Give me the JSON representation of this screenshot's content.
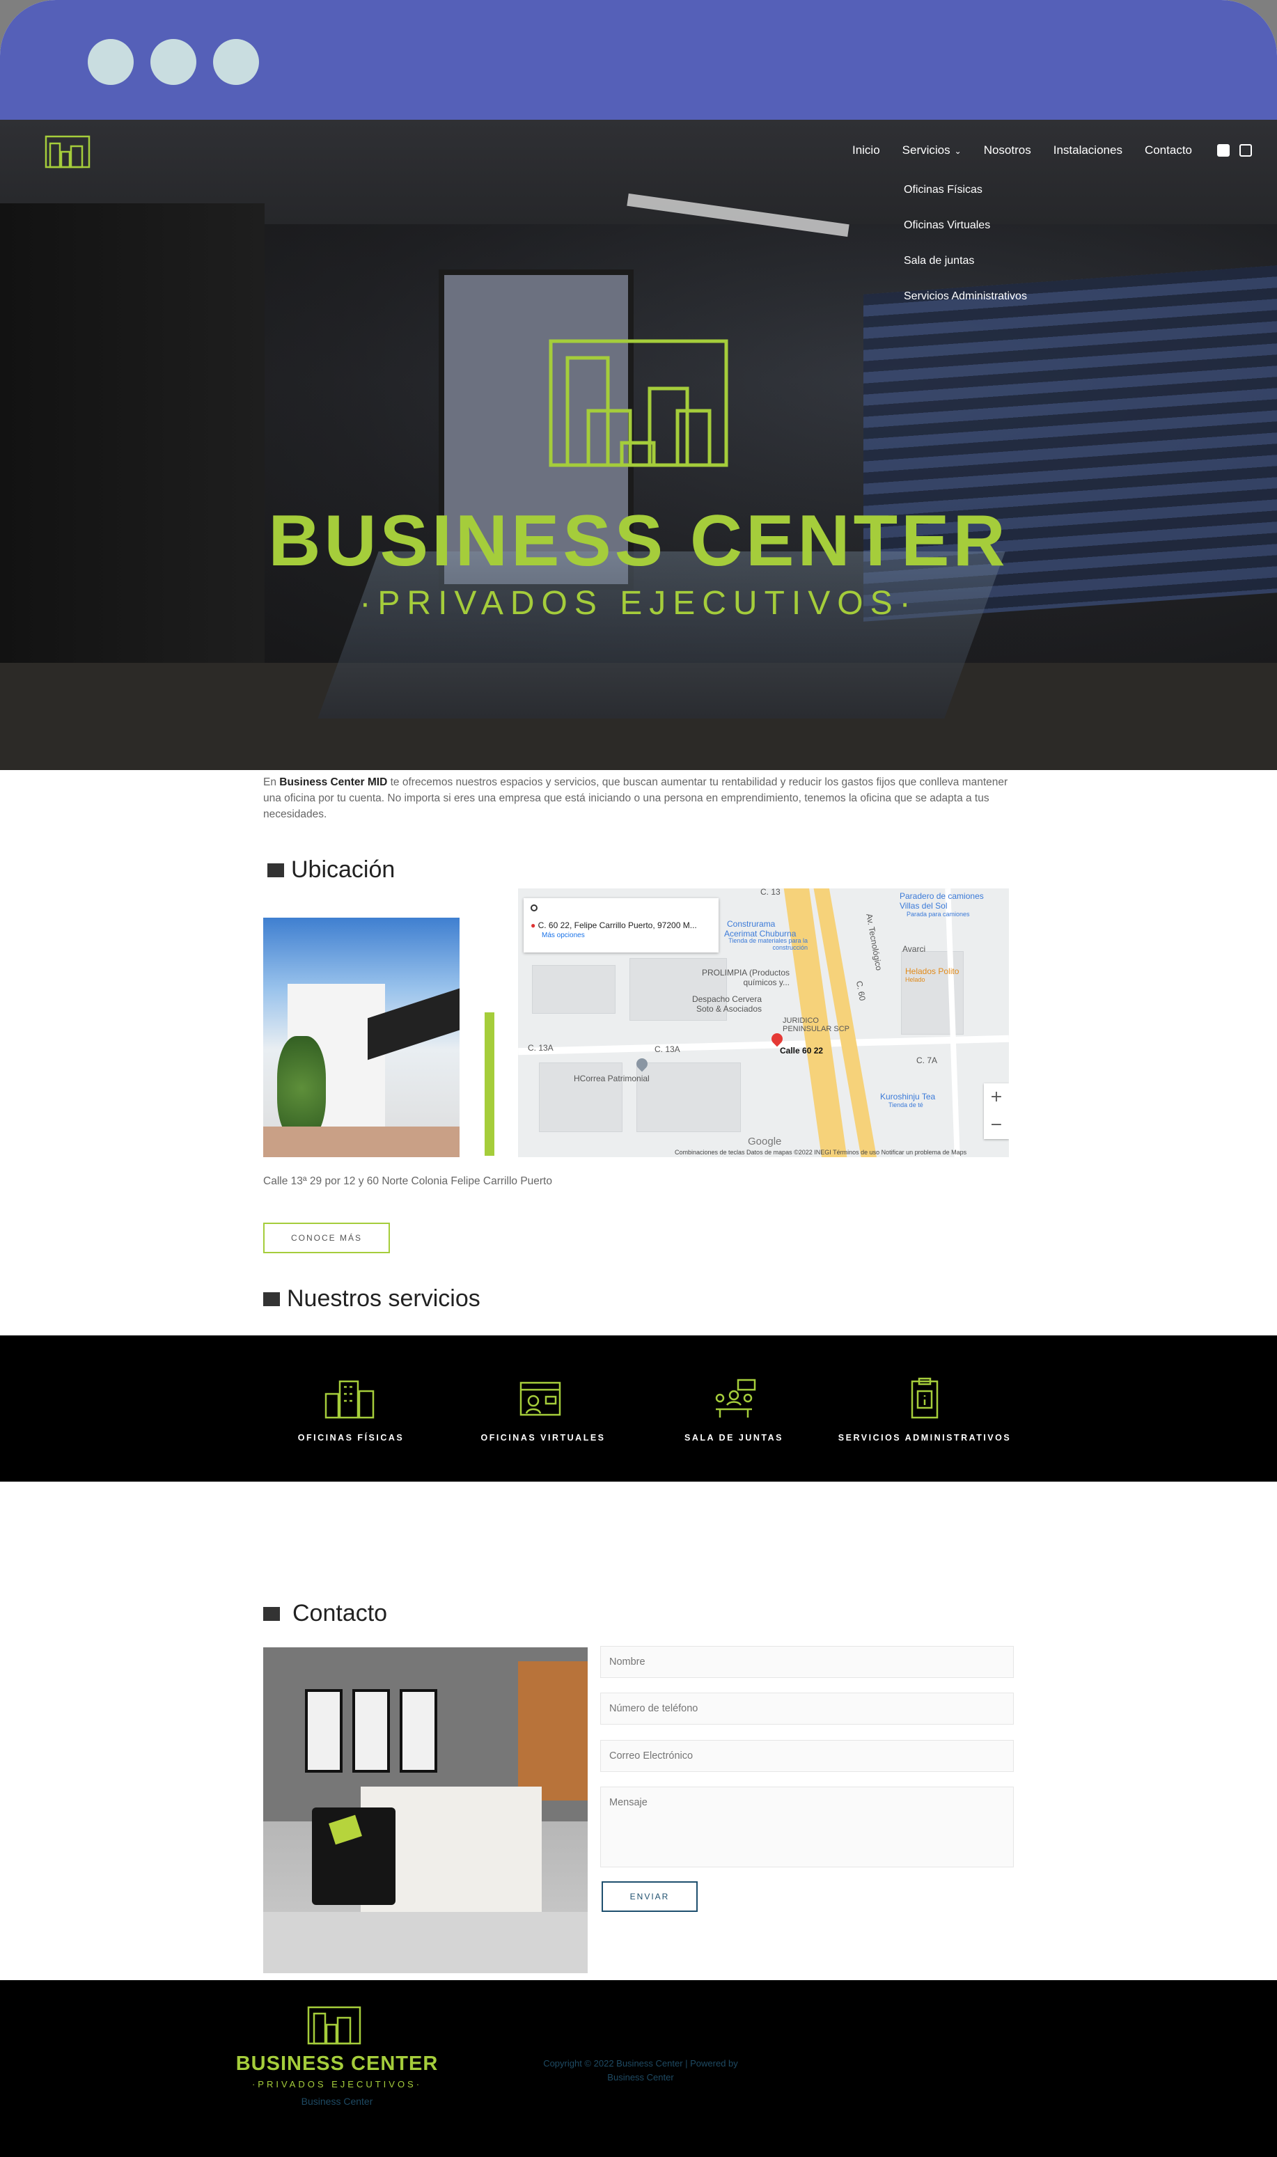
{
  "nav": {
    "items": [
      "Inicio",
      "Servicios",
      "Nosotros",
      "Instalaciones",
      "Contacto"
    ],
    "dropdown": [
      "Oficinas Físicas",
      "Oficinas Virtuales",
      "Sala de juntas",
      "Servicios Administrativos"
    ],
    "social": [
      "facebook-icon",
      "instagram-icon"
    ]
  },
  "hero": {
    "title": "BUSINESS CENTER",
    "subtitle": "·PRIVADOS EJECUTIVOS·"
  },
  "intro": {
    "before": "En ",
    "brand": "Business Center MID",
    "after": " te ofrecemos nuestros espacios y servicios, que buscan aumentar tu rentabilidad y reducir los gastos fijos que conlleva mantener una oficina por tu cuenta. No importa si eres una empresa que está iniciando o una persona en emprendimiento, tenemos la oficina que se adapta a tus necesidades."
  },
  "location": {
    "heading": "Ubicación",
    "address": "Calle 13ª 29 por 12 y 60 Norte Colonia Felipe Carrillo Puerto",
    "button": "CONOCE MÁS"
  },
  "map": {
    "card_address": "C. 60 22, Felipe Carrillo Puerto, 97200 M...",
    "card_more": "Más opciones",
    "labels": {
      "c13_top": "C. 13",
      "construrama": "Construrama",
      "acerimat": "Acerimat Chuburna",
      "acerimat_sub": "Tienda de materiales para la construcción",
      "paradero": "Paradero de camiones Villas del Sol",
      "paradero_sub": "Parada para camiones",
      "avarci": "Avarci",
      "helados": "Helados Polito",
      "helados_sub": "Helado",
      "prolimpia": "PROLIMPIA (Productos químicos y...",
      "despacho": "Despacho Cervera Soto & Asociados",
      "juridico": "JURIDICO PENINSULAR SCP",
      "calle6022": "Calle 60 22",
      "c13a_left": "C. 13A",
      "c13a_mid": "C. 13A",
      "c7a": "C. 7A",
      "c60": "C. 60",
      "av_tec": "Av. Tecnológico",
      "hcorrea": "HCorrea Patrimonial",
      "kuroshinju": "Kuroshinju Tea",
      "kuroshinju_sub": "Tienda de té",
      "google": "Google"
    },
    "footer": "Combinaciones de teclas   Datos de mapas ©2022 INEGI   Términos de uso   Notificar un problema de Maps",
    "zoom_in": "+",
    "zoom_out": "−"
  },
  "services": {
    "heading": "Nuestros servicios",
    "items": [
      "OFICINAS FÍSICAS",
      "OFICINAS VIRTUALES",
      "SALA DE JUNTAS",
      "SERVICIOS ADMINISTRATIVOS"
    ]
  },
  "contact": {
    "heading": "Contacto",
    "name_placeholder": "Nombre",
    "phone_placeholder": "Número de teléfono",
    "email_placeholder": "Correo Electrónico",
    "message_placeholder": "Mensaje",
    "send": "ENVIAR"
  },
  "footer": {
    "title": "BUSINESS CENTER",
    "subtitle": "·PRIVADOS EJECUTIVOS·",
    "name": "Business Center",
    "copyright_1": "Copyright © 2022 Business Center | Powered by",
    "copyright_2": "Business Center"
  },
  "colors": {
    "accent_green": "#a5cd3b",
    "chrome_blue": "#5560b8",
    "dark_blue": "#1e4a63"
  }
}
